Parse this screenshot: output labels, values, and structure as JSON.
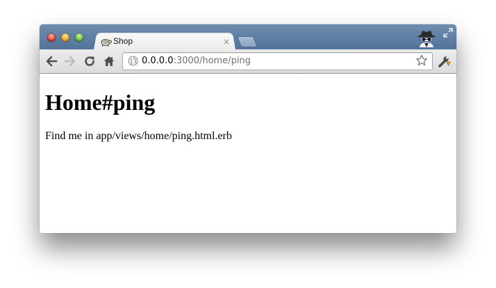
{
  "browser": {
    "tab": {
      "title": "Shop",
      "favicon": "turtle-icon",
      "close_glyph": "×"
    },
    "address_bar": {
      "host": "0.0.0.0",
      "rest": ":3000/home/ping"
    },
    "icons": {
      "back": "back-arrow-icon",
      "forward": "forward-arrow-icon",
      "reload": "reload-icon",
      "home": "home-icon",
      "site_info": "globe-icon",
      "bookmark": "star-icon",
      "settings": "wrench-icon",
      "incognito": "incognito-icon",
      "fullscreen": "fullscreen-icon"
    },
    "colors": {
      "tabstrip": "#52739a",
      "toolbar": "#e3e3e3"
    }
  },
  "page": {
    "heading": "Home#ping",
    "paragraph": "Find me in app/views/home/ping.html.erb"
  }
}
